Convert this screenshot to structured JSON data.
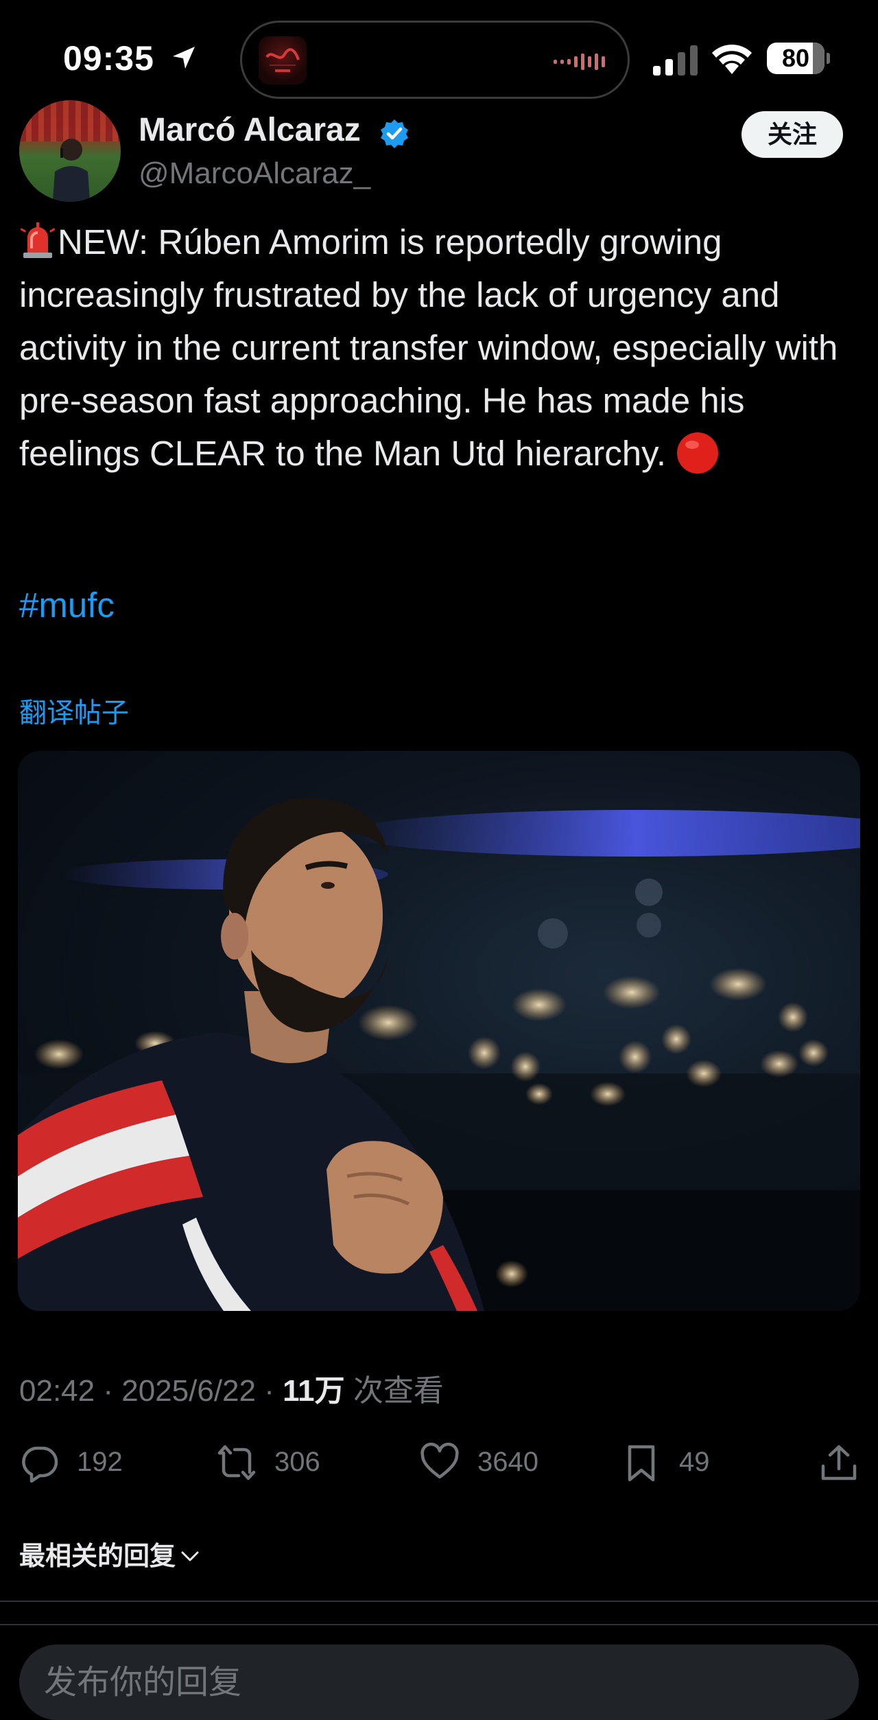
{
  "status_bar": {
    "time": "09:35",
    "battery_level": "80",
    "battery_fraction": 0.8
  },
  "author": {
    "name": "Marcó Alcaraz",
    "handle": "@MarcoAlcaraz_",
    "verified": true,
    "follow_label": "关注"
  },
  "tweet": {
    "text": "NEW: Rúben Amorim is reportedly growing increasingly frustrated by the lack of urgency and activity in the current transfer window, especially with pre-season fast approaching. He has made his feelings CLEAR to the Man Utd hierarchy.",
    "lead_emoji": "police-light-emoji",
    "trail_emoji": "red-circle-emoji",
    "hashtag": "#mufc",
    "translate_label": "翻译帖子",
    "time": "02:42",
    "date": "2025/6/22",
    "views": "11万",
    "views_label": "次查看",
    "separator": "·"
  },
  "actions": {
    "replies": "192",
    "reposts": "306",
    "likes": "3640",
    "bookmarks": "49"
  },
  "replies_section": {
    "sort_label": "最相关的回复"
  },
  "compose": {
    "placeholder": "发布你的回复"
  },
  "colors": {
    "background": "#000000",
    "text_primary": "#e7e9ea",
    "text_secondary": "#71767b",
    "link": "#1d9bf0",
    "verified": "#1d9bf0",
    "divider": "#2f3336",
    "input_bg": "#202327",
    "follow_bg": "#eff3f4"
  }
}
